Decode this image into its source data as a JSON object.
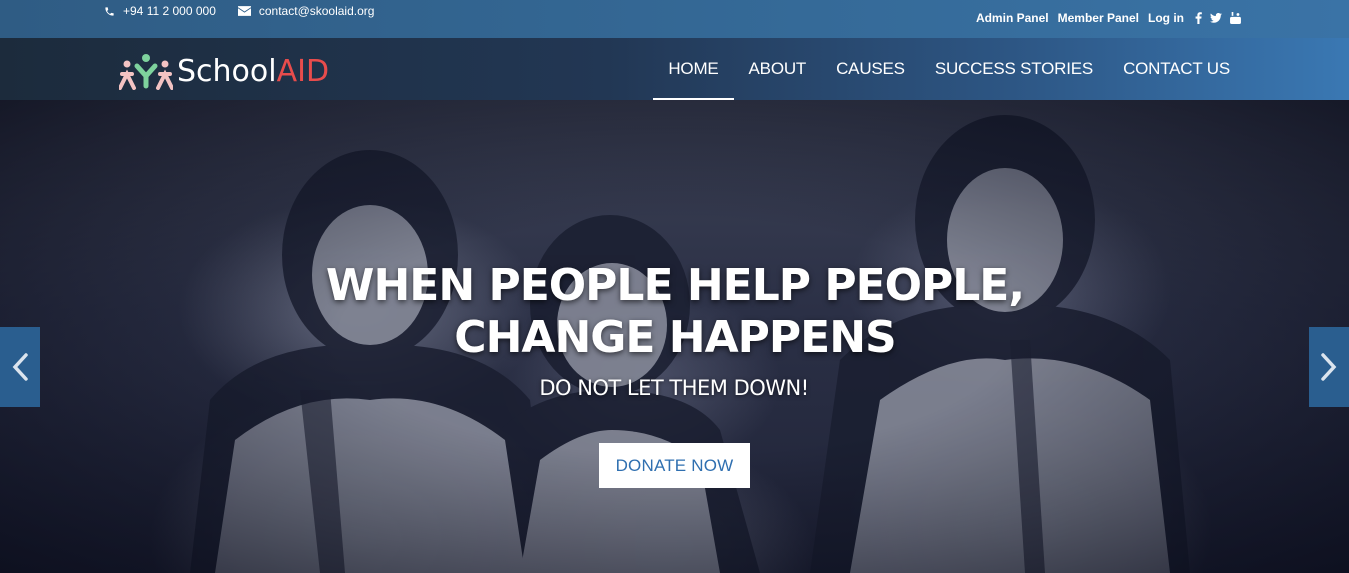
{
  "topbar": {
    "phone": "+94 11 2 000 000",
    "email": "contact@skoolaid.org",
    "links": [
      "Admin Panel",
      "Member Panel",
      "Log in"
    ],
    "social_icons": [
      "facebook-icon",
      "twitter-icon",
      "youtube-icon"
    ]
  },
  "logo": {
    "text_school": "School",
    "text_aid": "AID"
  },
  "nav": {
    "items": [
      "HOME",
      "ABOUT",
      "CAUSES",
      "SUCCESS STORIES",
      "CONTACT US"
    ],
    "active": "HOME"
  },
  "hero": {
    "title": "WHEN PEOPLE HELP PEOPLE, CHANGE HAPPENS",
    "subtitle": "DO NOT LET THEM DOWN!",
    "button": "DONATE NOW"
  },
  "colors": {
    "topbar": "#356a98",
    "accent": "#2f6fb0",
    "logo_aid": "#e74c4c",
    "arrow_bg": "#2a5e8f"
  }
}
